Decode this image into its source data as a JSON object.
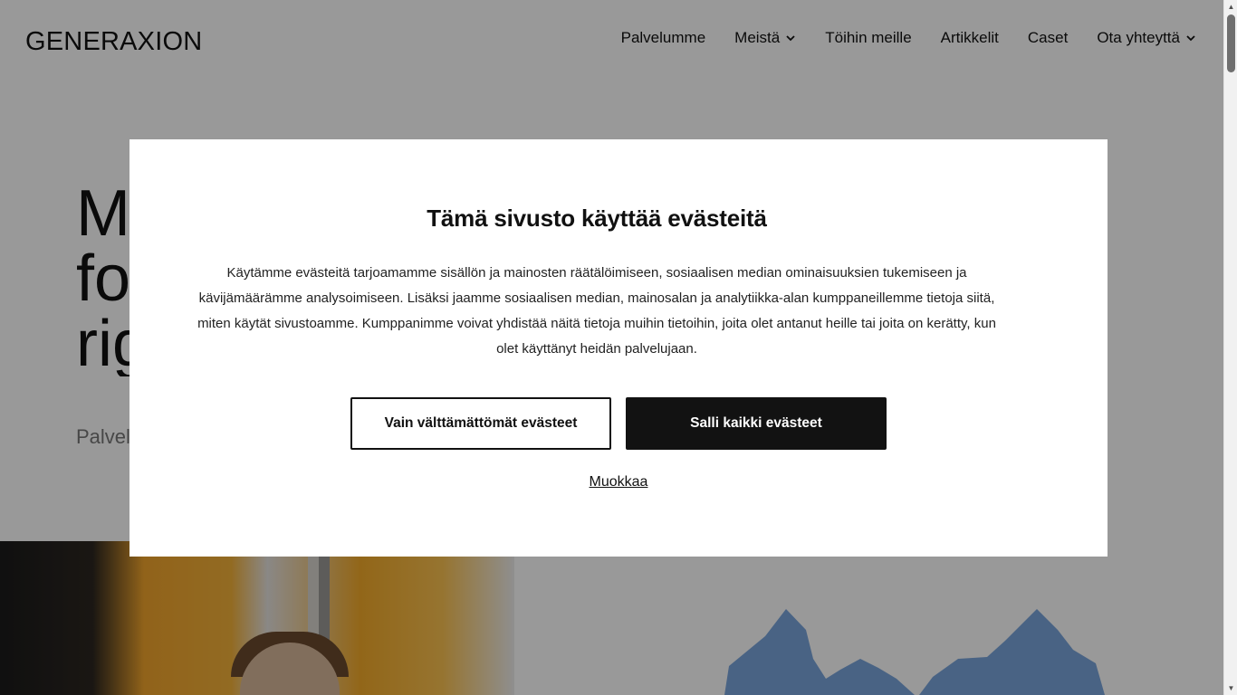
{
  "header": {
    "logo_text": "GENERAXION",
    "nav": [
      {
        "label": "Palvelumme",
        "has_dropdown": false
      },
      {
        "label": "Meistä",
        "has_dropdown": true
      },
      {
        "label": "Töihin meille",
        "has_dropdown": false
      },
      {
        "label": "Artikkelit",
        "has_dropdown": false
      },
      {
        "label": "Caset",
        "has_dropdown": false
      },
      {
        "label": "Ota yhteyttä",
        "has_dropdown": true
      }
    ]
  },
  "hero": {
    "title_visible": "M\nfo\nrig",
    "subtitle_visible": "Palvel"
  },
  "cookie_dialog": {
    "title": "Tämä sivusto käyttää evästeitä",
    "body": "Käytämme evästeitä tarjoamamme sisällön ja mainosten räätälöimiseen, sosiaalisen median ominaisuuksien tukemiseen ja kävijämäärämme analysoimiseen. Lisäksi jaamme sosiaalisen median, mainosalan ja analytiikka-alan kumppaneillemme tietoja siitä, miten käytät sivustoamme. Kumppanimme voivat yhdistää näitä tietoja muihin tietoihin, joita olet antanut heille tai joita on kerätty, kun olet käyttänyt heidän palvelujaan.",
    "necessary_button": "Vain välttämättömät evästeet",
    "allow_all_button": "Salli kaikki evästeet",
    "customize_link": "Muokkaa"
  },
  "colors": {
    "overlay": "#000000",
    "primary_button_bg": "#121212",
    "text": "#111111",
    "hero_photo_accent": "#f4b23a",
    "shape_blue": "#7aa6dc"
  },
  "icons": {
    "logo": "generaxion-logo",
    "dropdown": "chevron-down-icon"
  }
}
